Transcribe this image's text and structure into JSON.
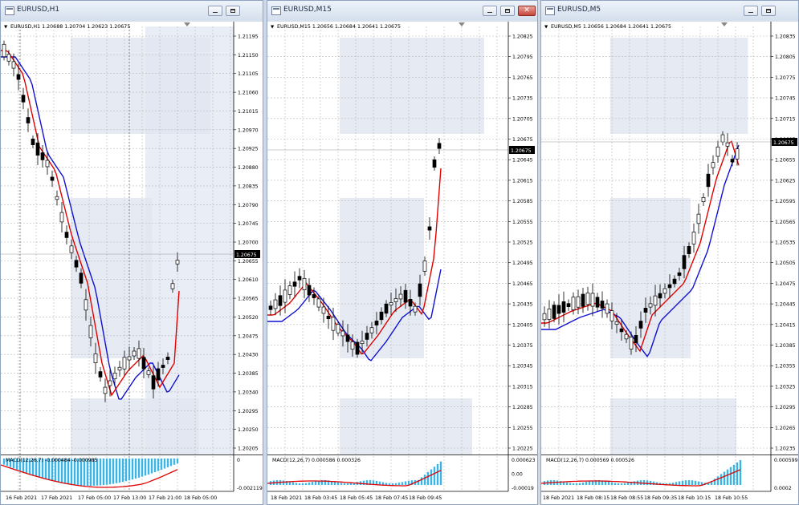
{
  "windows": [
    {
      "title": "EURUSD,H1",
      "header": "EURUSD,H1  1.20688 1.20704 1.20623 1.20675",
      "active": false,
      "show_close": false,
      "price_ticks": [
        "1.21195",
        "1.21150",
        "1.21105",
        "1.21060",
        "1.21015",
        "1.20970",
        "1.20925",
        "1.20880",
        "1.20835",
        "1.20790",
        "1.20745",
        "1.20700",
        "1.20655",
        "1.20610",
        "1.20565",
        "1.20520",
        "1.20475",
        "1.20430",
        "1.20385",
        "1.20340",
        "1.20295",
        "1.20250",
        "1.20205"
      ],
      "price_range": [
        1.2019,
        1.2124
      ],
      "current_price": "1.20675",
      "indicator_label": "MACD(12,26,7) -0.000484 -0.000985",
      "indicator_ticks": [
        "0",
        "-0.002119"
      ],
      "time_labels": [
        "16 Feb 2021",
        "17 Feb 2021",
        "17 Feb 05:00",
        "17 Feb 13:00",
        "17 Feb 21:00",
        "18 Feb 05:00"
      ]
    },
    {
      "title": "EURUSD,M15",
      "header": "EURUSD,M15  1.20656 1.20684 1.20641 1.20675",
      "active": true,
      "show_close": true,
      "price_ticks": [
        "1.20825",
        "1.20795",
        "1.20765",
        "1.20735",
        "1.20705",
        "1.20675",
        "1.20645",
        "1.20615",
        "1.20585",
        "1.20555",
        "1.20525",
        "1.20495",
        "1.20465",
        "1.20435",
        "1.20405",
        "1.20375",
        "1.20345",
        "1.20315",
        "1.20285",
        "1.20255",
        "1.20225"
      ],
      "price_range": [
        1.2022,
        1.2084
      ],
      "current_price": "1.20675",
      "indicator_label": "MACD(12,26,7) 0.000586 0.000326",
      "indicator_ticks": [
        "0.000623",
        "0.00",
        "-0.00019"
      ],
      "time_labels": [
        "18 Feb 2021",
        "18 Feb 03:45",
        "18 Feb 05:45",
        "18 Feb 07:45",
        "18 Feb 09:45"
      ]
    },
    {
      "title": "EURUSD,M5",
      "header": "EURUSD,M5  1.20656 1.20684 1.20641 1.20675",
      "active": false,
      "show_close": false,
      "price_ticks": [
        "1.20835",
        "1.20805",
        "1.20775",
        "1.20745",
        "1.20715",
        "1.20685",
        "1.20655",
        "1.20625",
        "1.20595",
        "1.20565",
        "1.20535",
        "1.20505",
        "1.20475",
        "1.20445",
        "1.20415",
        "1.20385",
        "1.20355",
        "1.20325",
        "1.20295",
        "1.20265",
        "1.20235"
      ],
      "price_range": [
        1.2023,
        1.2084
      ],
      "current_price": "1.20675",
      "indicator_label": "MACD(12,26,7) 0.000569 0.000526",
      "indicator_ticks": [
        "0.000599",
        "0.0002"
      ],
      "time_labels": [
        "18 Feb 2021",
        "18 Feb 08:15",
        "18 Feb 08:55",
        "18 Feb 09:35",
        "18 Feb 10:15",
        "18 Feb 10:55"
      ]
    }
  ],
  "colors": {
    "bull_candle": "#ffffff",
    "bear_candle": "#000000",
    "fast_ma": "#e00000",
    "slow_ma": "#1010d0",
    "histogram": "#3cb4e6",
    "signal": "#e00000",
    "grid": "#b8b8b8",
    "watermark": "#e6ebf3"
  },
  "icons": [
    "window-icon",
    "minimize-icon",
    "maximize-icon",
    "close-icon",
    "dropdown-arrow-icon"
  ]
}
